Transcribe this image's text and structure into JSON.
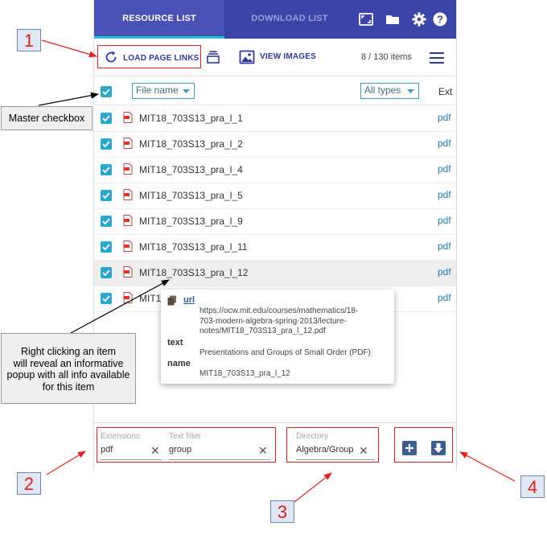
{
  "tabs": {
    "resource_list": "RESOURCE LIST",
    "download_list": "DOWNLOAD LIST"
  },
  "header_icons": [
    "fullscreen-icon",
    "folder-icon",
    "gear-icon",
    "help-icon"
  ],
  "toolbar": {
    "load_links": "LOAD PAGE LINKS",
    "view_images": "VIEW IMAGES",
    "count": "8 / 130 items"
  },
  "columns": {
    "file_name": "File name",
    "all_types": "All types",
    "ext": "Ext"
  },
  "rows": [
    {
      "name": "MIT18_703S13_pra_l_1",
      "ext": "pdf"
    },
    {
      "name": "MIT18_703S13_pra_l_2",
      "ext": "pdf"
    },
    {
      "name": "MIT18_703S13_pra_l_4",
      "ext": "pdf"
    },
    {
      "name": "MIT18_703S13_pra_l_5",
      "ext": "pdf"
    },
    {
      "name": "MIT18_703S13_pra_l_9",
      "ext": "pdf"
    },
    {
      "name": "MIT18_703S13_pra_l_11",
      "ext": "pdf"
    },
    {
      "name": "MIT18_703S13_pra_l_12",
      "ext": "pdf"
    },
    {
      "name": "MIT1",
      "ext": "pdf"
    }
  ],
  "popup": {
    "url_label": "url",
    "url_value_1": "https://ocw.mit.edu/courses/mathematics/18-",
    "url_value_2": "703-modern-algebra-spring-2013/lecture-",
    "url_value_3": "notes/MIT18_703S13_pra_l_12.pdf",
    "text_label": "text",
    "text_value": "Presentations and Groups of Small Order (PDF)",
    "name_label": "name",
    "name_value": "MIT18_703S13_pra_l_12"
  },
  "footer": {
    "extensions_label": "Extensions",
    "extensions_value": "pdf",
    "text_filter_label": "Text filter",
    "text_filter_value": "group",
    "directory_label": "Directory",
    "directory_value": "Algebra/Group"
  },
  "annotations": {
    "n1": "1",
    "n2": "2",
    "n3": "3",
    "n4": "4",
    "master_checkbox": "Master checkbox",
    "right_click_1": "Right clicking an item",
    "right_click_2": "will reveal an informative",
    "right_click_3": "popup with all info available",
    "right_click_4": "for this item"
  },
  "colors": {
    "header": "#3d44a7",
    "accent": "#2aa7c9",
    "annotation_red": "#e12020"
  }
}
